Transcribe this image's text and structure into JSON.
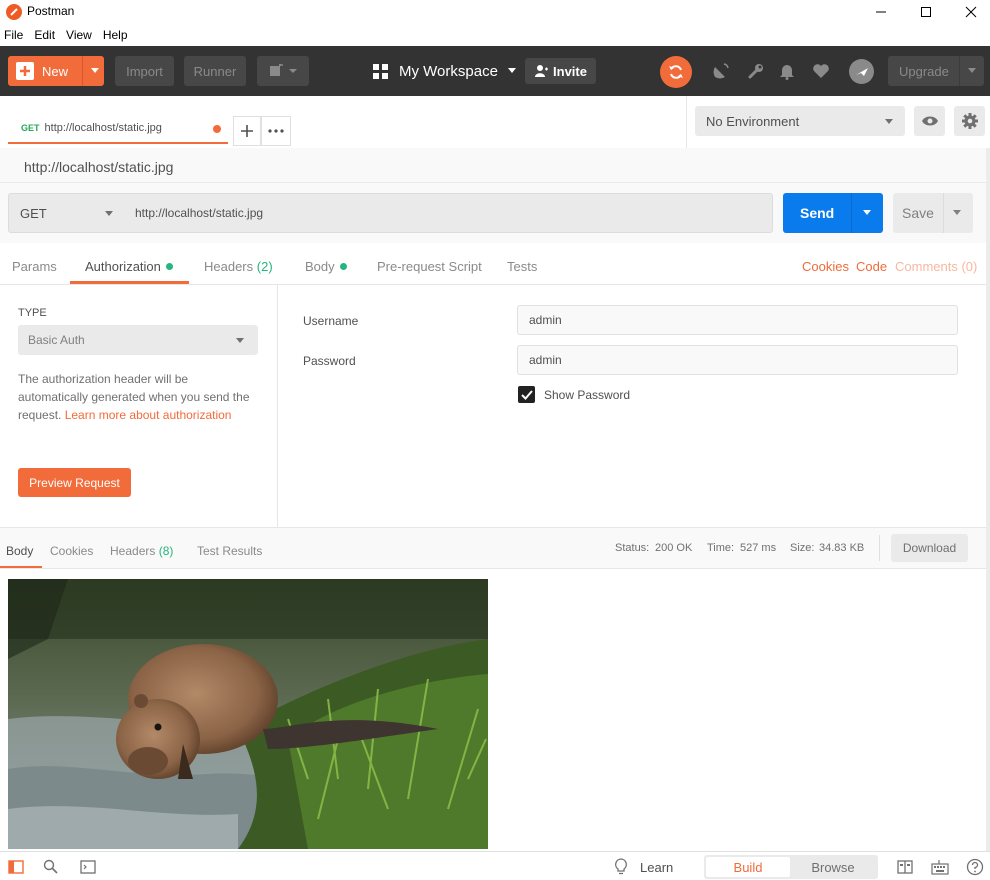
{
  "window": {
    "title": "Postman"
  },
  "menu": [
    "File",
    "Edit",
    "View",
    "Help"
  ],
  "header": {
    "new_label": "New",
    "import_label": "Import",
    "runner_label": "Runner",
    "workspace_name": "My Workspace",
    "invite_label": "Invite",
    "upgrade_label": "Upgrade"
  },
  "tab": {
    "method": "GET",
    "url": "http://localhost/static.jpg"
  },
  "environment": {
    "selected": "No Environment"
  },
  "request": {
    "title": "http://localhost/static.jpg",
    "method": "GET",
    "url": "http://localhost/static.jpg",
    "send_label": "Send",
    "save_label": "Save"
  },
  "request_tabs": {
    "params": "Params",
    "authorization": "Authorization",
    "headers": "Headers",
    "headers_count": "(2)",
    "body": "Body",
    "prerequest": "Pre-request Script",
    "tests": "Tests",
    "cookies": "Cookies",
    "code": "Code",
    "comments": "Comments (0)"
  },
  "auth": {
    "type_label": "TYPE",
    "type_value": "Basic Auth",
    "description": "The authorization header will be automatically generated when you send the request. ",
    "learn_more": "Learn more about authorization",
    "preview_label": "Preview Request",
    "username_label": "Username",
    "username_value": "admin",
    "password_label": "Password",
    "password_value": "admin",
    "show_password_label": "Show Password",
    "show_password_checked": true
  },
  "response": {
    "tabs": {
      "body": "Body",
      "cookies": "Cookies",
      "headers": "Headers",
      "headers_count": "(8)",
      "tests": "Test Results"
    },
    "status_label": "Status:",
    "status_value": "200 OK",
    "time_label": "Time:",
    "time_value": "527 ms",
    "size_label": "Size:",
    "size_value": "34.83 KB",
    "download_label": "Download"
  },
  "statusbar": {
    "learn_label": "Learn",
    "build_label": "Build",
    "browse_label": "Browse"
  },
  "colors": {
    "brand": "#f26b3a",
    "send": "#097bed",
    "success": "#26b47f",
    "header_bg": "#333333"
  }
}
